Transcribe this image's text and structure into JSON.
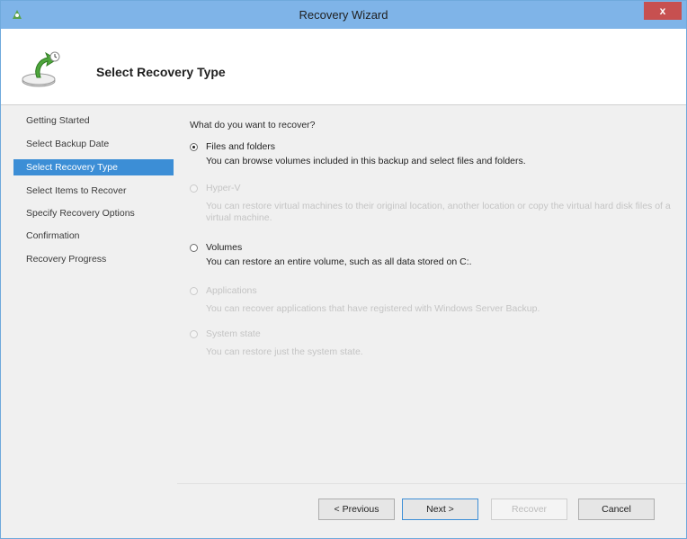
{
  "window": {
    "title": "Recovery Wizard",
    "close_symbol": "x"
  },
  "header": {
    "page_title": "Select Recovery Type"
  },
  "steps": [
    {
      "label": "Getting Started",
      "active": false
    },
    {
      "label": "Select Backup Date",
      "active": false
    },
    {
      "label": "Select Recovery Type",
      "active": true
    },
    {
      "label": "Select Items to Recover",
      "active": false
    },
    {
      "label": "Specify Recovery Options",
      "active": false
    },
    {
      "label": "Confirmation",
      "active": false
    },
    {
      "label": "Recovery Progress",
      "active": false
    }
  ],
  "content": {
    "question": "What do you want to recover?",
    "options": [
      {
        "label": "Files and folders",
        "checked": true,
        "enabled": true,
        "description": "You can browse volumes included in this backup and select files and folders."
      },
      {
        "label": "Hyper-V",
        "checked": false,
        "enabled": false,
        "description": "You can restore virtual machines to their original location, another location or copy the virtual hard disk files of a virtual machine."
      },
      {
        "label": "Volumes",
        "checked": false,
        "enabled": true,
        "description": "You can restore an entire volume, such as all data stored on C:."
      },
      {
        "label": "Applications",
        "checked": false,
        "enabled": false,
        "description": "You can recover applications that have registered with Windows Server Backup."
      },
      {
        "label": "System state",
        "checked": false,
        "enabled": false,
        "description": "You can restore just the system state."
      }
    ]
  },
  "buttons": {
    "previous": "< Previous",
    "next": "Next >",
    "recover": "Recover",
    "cancel": "Cancel"
  },
  "colors": {
    "titlebar": "#7fb4e8",
    "selection": "#3c8ed6",
    "close": "#c75050"
  }
}
